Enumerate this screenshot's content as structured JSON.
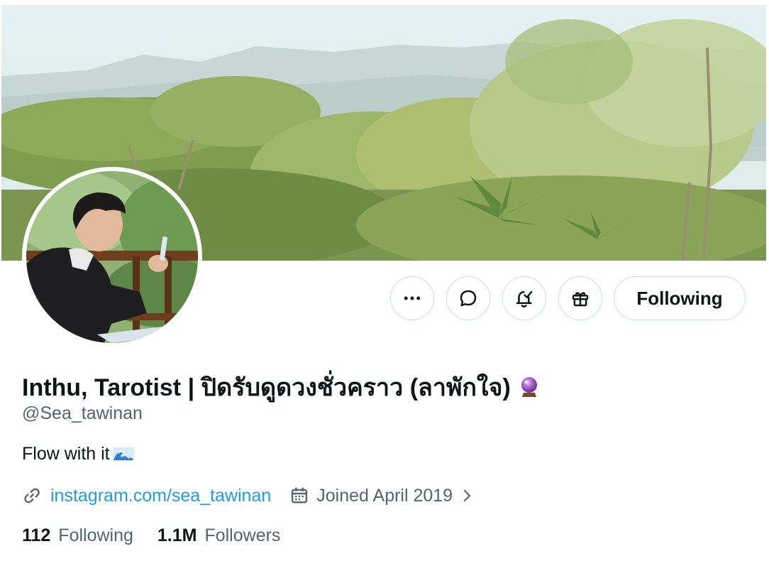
{
  "profile": {
    "display_name": "Inthu, Tarotist | ปิดรับดูดวงชั่วคราว (ลาพักใจ)",
    "name_emoji": "crystal-ball",
    "handle": "@Sea_tawinan",
    "bio": "Flow with it",
    "bio_emoji": "water-wave",
    "website": "instagram.com/sea_tawinan",
    "joined": "Joined April 2019"
  },
  "actions": {
    "follow_label": "Following",
    "icons": [
      "more-icon",
      "message-icon",
      "notification-icon",
      "gift-icon"
    ]
  },
  "stats": {
    "following_count": "112",
    "following_label": "Following",
    "followers_count": "1.1M",
    "followers_label": "Followers"
  },
  "colors": {
    "link": "#1d9bf0",
    "secondary_text": "#536471",
    "primary_text": "#0f1419",
    "border": "#cfd9de"
  }
}
